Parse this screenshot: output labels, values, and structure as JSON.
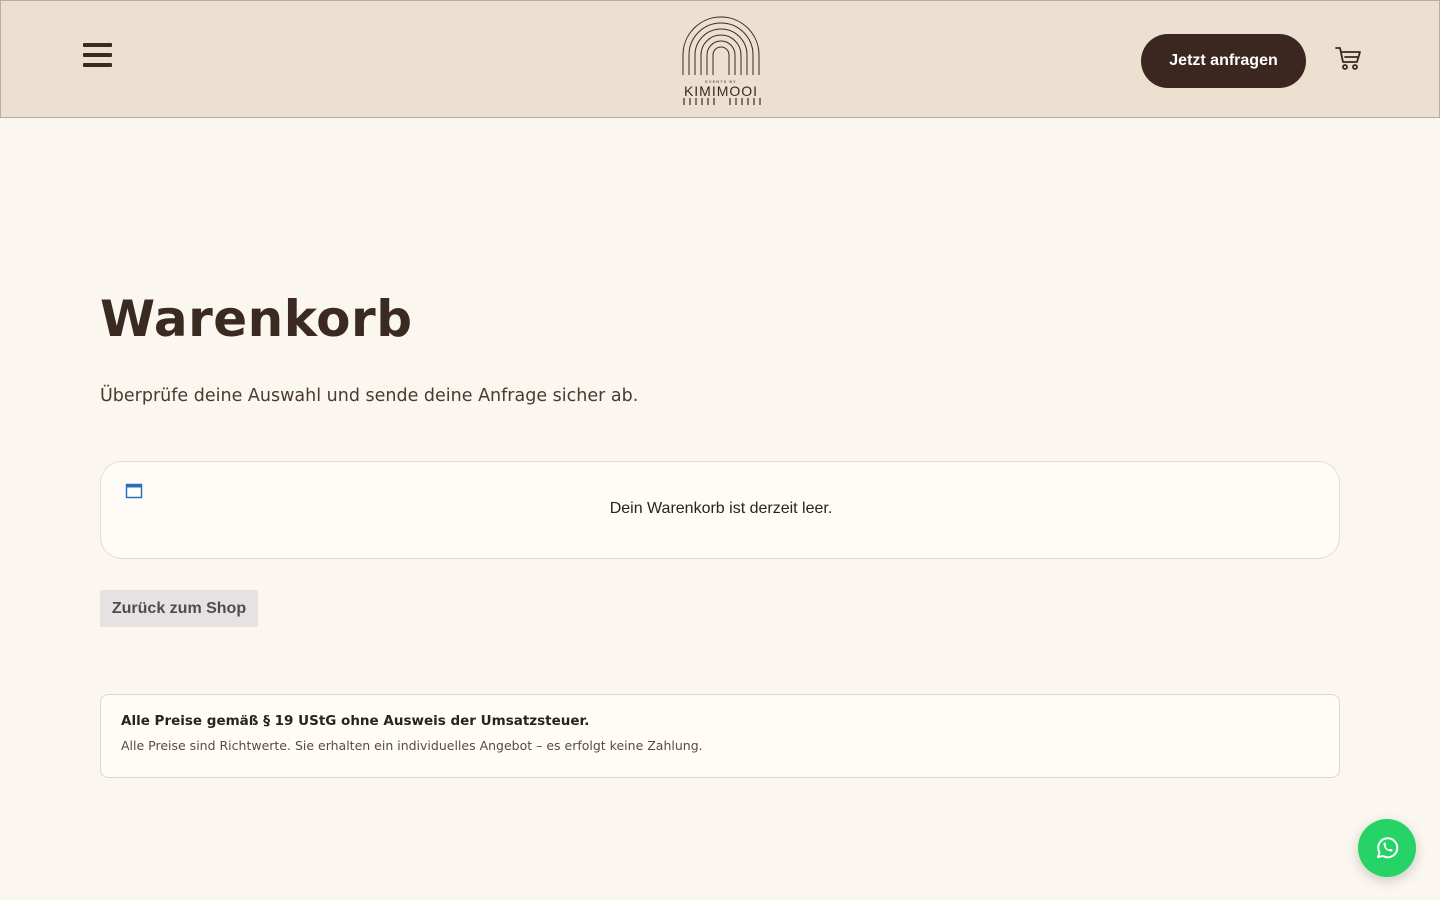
{
  "header": {
    "menu_icon": "hamburger-menu-icon",
    "logo": {
      "small_text": "EVENTS BY",
      "name": "KIMIMOOI"
    },
    "cta_label": "Jetzt anfragen",
    "cart_icon": "shopping-cart-icon"
  },
  "main": {
    "title": "Warenkorb",
    "subtitle": "Überprüfe deine Auswahl und sende deine Anfrage sicher ab.",
    "cart": {
      "notice_icon": "window-icon",
      "empty_message": "Dein Warenkorb ist derzeit leer."
    },
    "back_button_label": "Zurück zum Shop",
    "tax_notice": {
      "heading": "Alle Preise gemäß § 19 UStG ohne Ausweis der Umsatzsteuer.",
      "text": "Alle Preise sind Richtwerte. Sie erhalten ein individuelles Angebot – es erfolgt keine Zahlung."
    }
  },
  "floating": {
    "whatsapp_icon": "whatsapp-icon"
  },
  "colors": {
    "header_bg": "#ece0d0",
    "page_bg": "#fbf6f0",
    "cta_bg": "#3b2720",
    "text_dark": "#3a2a22",
    "whatsapp_green": "#25d366"
  }
}
